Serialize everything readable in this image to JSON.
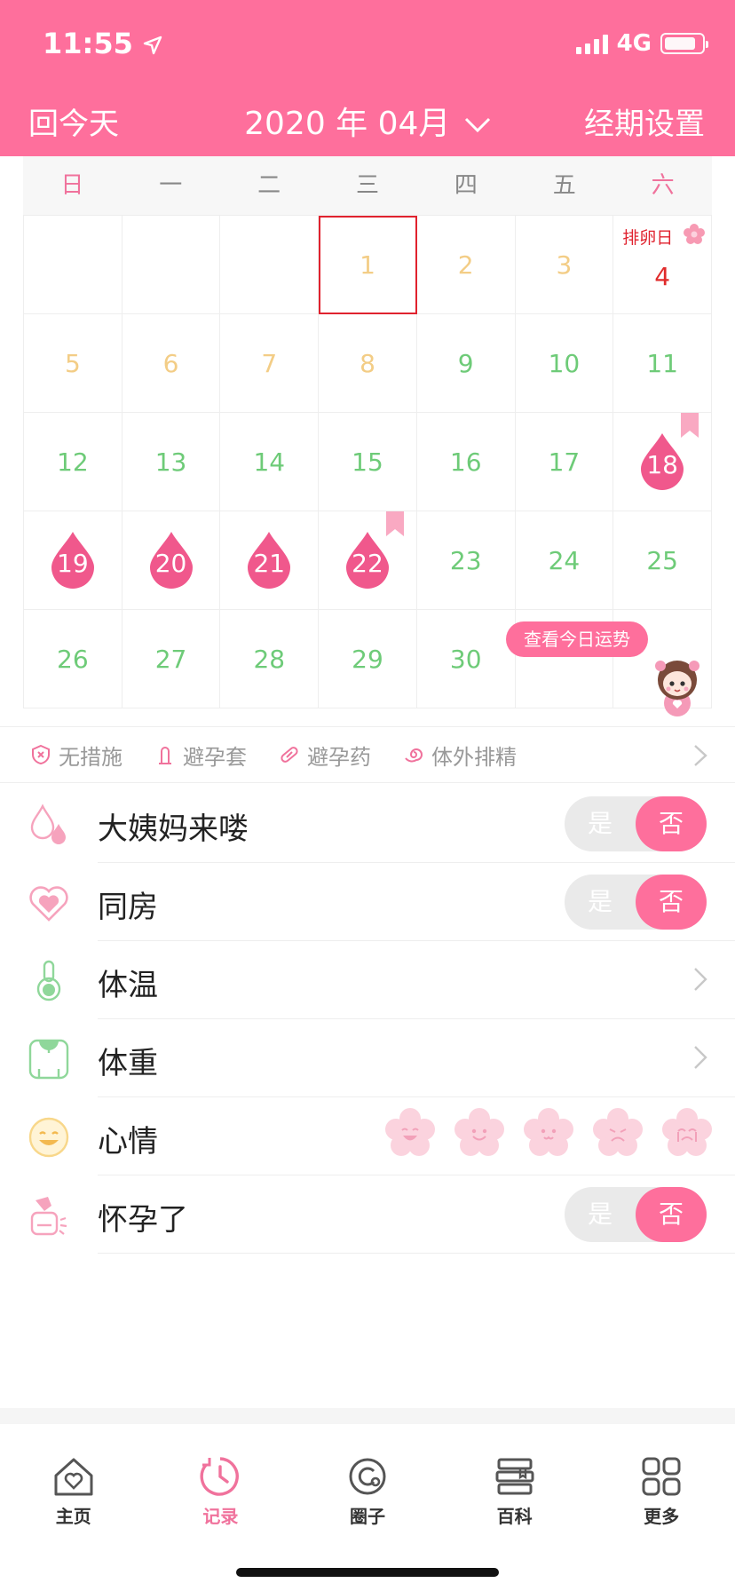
{
  "status_bar": {
    "time": "11:55",
    "network": "4G"
  },
  "header": {
    "back_today": "回今天",
    "title": "2020 年 04月",
    "settings": "经期设置"
  },
  "weekdays": [
    "日",
    "一",
    "二",
    "三",
    "四",
    "五",
    "六"
  ],
  "calendar": {
    "row1": {
      "d1": "1",
      "d2": "2",
      "d3": "3",
      "d4": "4",
      "ovulation_label": "排卵日"
    },
    "row2": [
      "5",
      "6",
      "7",
      "8",
      "9",
      "10",
      "11"
    ],
    "row3": [
      "12",
      "13",
      "14",
      "15",
      "16",
      "17",
      "18"
    ],
    "row4": [
      "19",
      "20",
      "21",
      "22",
      "23",
      "24",
      "25"
    ],
    "row5": [
      "26",
      "27",
      "28",
      "29",
      "30"
    ],
    "fortune_button": "查看今日运势"
  },
  "contraception": {
    "none": "无措施",
    "condom": "避孕套",
    "pill": "避孕药",
    "withdrawal": "体外排精"
  },
  "records": {
    "period": {
      "label": "大姨妈来喽",
      "yes": "是",
      "no": "否"
    },
    "intimacy": {
      "label": "同房",
      "yes": "是",
      "no": "否"
    },
    "temperature": {
      "label": "体温"
    },
    "weight": {
      "label": "体重"
    },
    "mood": {
      "label": "心情"
    },
    "pregnant": {
      "label": "怀孕了",
      "yes": "是",
      "no": "否"
    }
  },
  "tabs": {
    "home": "主页",
    "record": "记录",
    "circle": "圈子",
    "wiki": "百科",
    "more": "更多"
  },
  "colors": {
    "brand": "#fe6f9c",
    "period": "#f0588c",
    "future_green": "#6ecb78",
    "past_yellow": "#f3cd86",
    "ovulation_red": "#e0222e"
  }
}
